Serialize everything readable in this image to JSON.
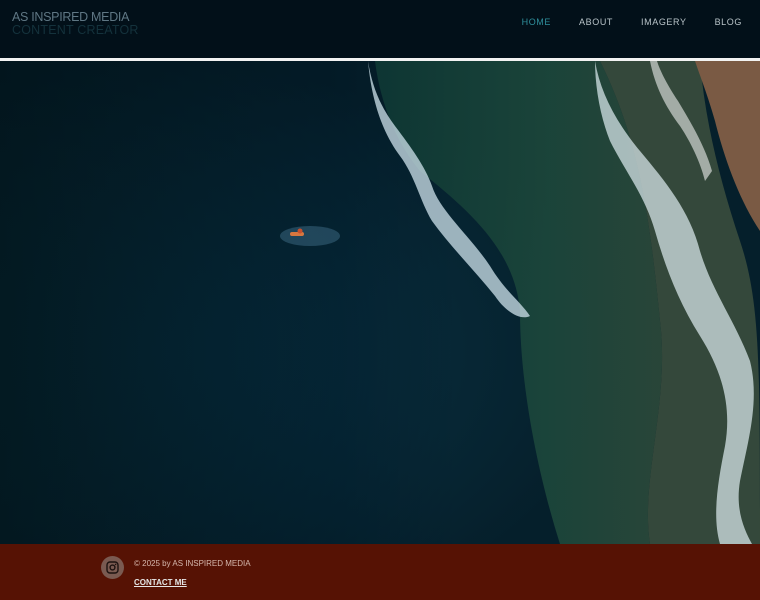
{
  "header": {
    "brand_title": "AS INSPIRED MEDIA",
    "brand_subtitle": "CONTENT CREATOR"
  },
  "nav": {
    "items": [
      {
        "label": "HOME",
        "active": true
      },
      {
        "label": "ABOUT",
        "active": false
      },
      {
        "label": "IMAGERY",
        "active": false
      },
      {
        "label": "BLOG",
        "active": false
      }
    ]
  },
  "hero": {
    "icon": "aerial-ocean-photo"
  },
  "footer": {
    "copyright": "© 2025 by AS INSPIRED MEDIA",
    "contact_label": "CONTACT ME",
    "social_icon": "instagram-icon"
  },
  "colors": {
    "header_bg": "#021019",
    "nav_active": "#2f8f9c",
    "footer_bg": "#561204"
  }
}
